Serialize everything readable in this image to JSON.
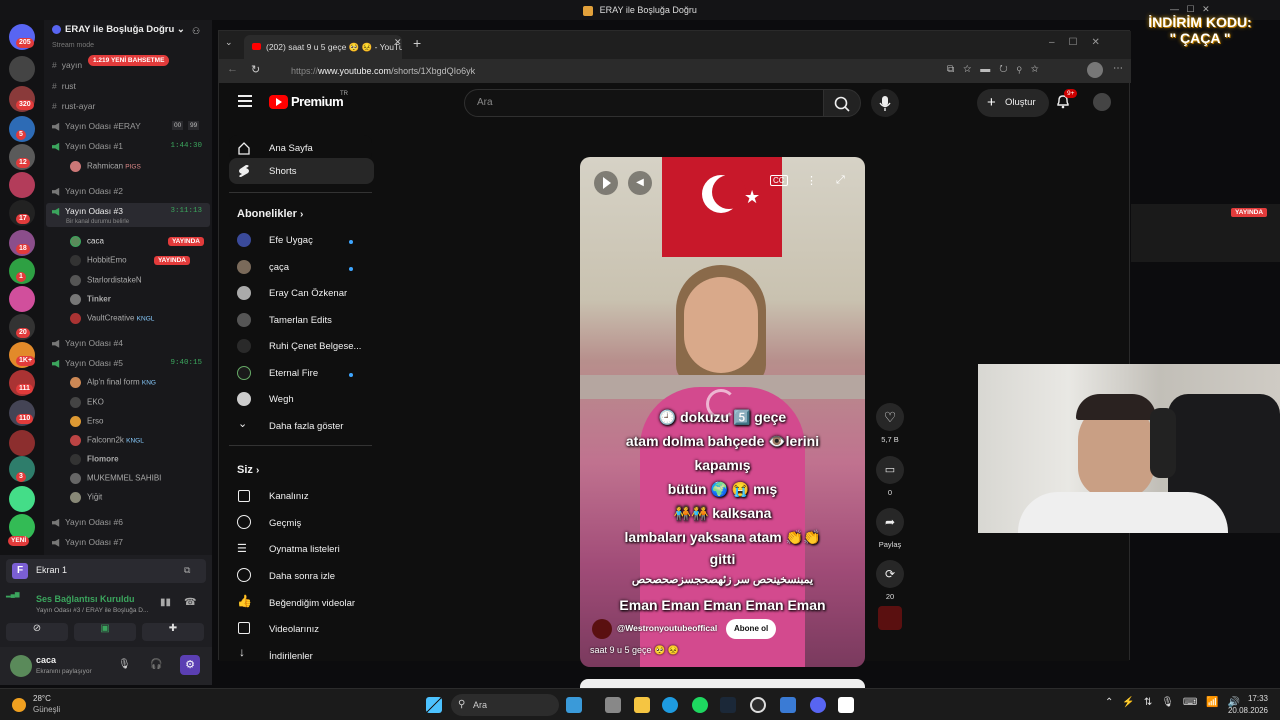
{
  "window_title": "ERAY ile Boşluğa Doğru",
  "promo": {
    "line1": "İNDİRİM KODU:",
    "line2": "\" ÇAÇA \""
  },
  "discord": {
    "server_badges": [
      "205",
      "320",
      "5",
      "12",
      "17",
      "18",
      "1",
      "20",
      "1K+",
      "111",
      "110",
      "3",
      "YENİ"
    ],
    "server_name": "ERAY ile Boşluğa Doğru",
    "stream_mode": "Stream mode",
    "new_since": "1.219 YENİ BAHSETME",
    "text_channels": [
      "yayın",
      "rust",
      "rust-ayar"
    ],
    "voice": [
      {
        "name": "Yayın Odası #ERAY",
        "counts": [
          "00",
          "99"
        ]
      },
      {
        "name": "Yayın Odası #1",
        "time": "1:44:30",
        "users": [
          {
            "name": "Rahmican",
            "tag": "PIGS"
          }
        ]
      },
      {
        "name": "Yayın Odası #2"
      },
      {
        "name": "Yayın Odası #3",
        "time": "3:11:13",
        "status": "Bir kanal durumu belirle",
        "users": [
          {
            "name": "caca",
            "live": "YAYINDA"
          },
          {
            "name": "HobbitEmo",
            "live": "YAYINDA"
          },
          {
            "name": "StarlordistakeN"
          },
          {
            "name": "Tinker"
          },
          {
            "name": "VaultCreative",
            "tag": "KNGL"
          }
        ]
      },
      {
        "name": "Yayın Odası #4"
      },
      {
        "name": "Yayın Odası #5",
        "time": "9:40:15",
        "users": [
          {
            "name": "Alp'n final form",
            "tag": "KNG"
          },
          {
            "name": "EKO"
          },
          {
            "name": "Erso"
          },
          {
            "name": "Falconn2k",
            "tag": "KNGL"
          },
          {
            "name": "Flomore"
          },
          {
            "name": "MUKEMMEL SAHIBI"
          },
          {
            "name": "Yiğit"
          }
        ]
      },
      {
        "name": "Yayın Odası #6"
      },
      {
        "name": "Yayın Odası #7"
      }
    ],
    "screen_share": "Ekran 1",
    "connection": "Ses Bağlantısı Kuruldu",
    "connection_sub": "Yayın Odası #3 / ERAY ile Boşluğa D...",
    "me_name": "caca",
    "me_status": "Ekranını paylaşıyor"
  },
  "browser": {
    "tab_title": "(202) saat 9 u 5 geçe 🥺 😣 - YouTube",
    "url_prefix": "https://",
    "url_host": "www.youtube.com",
    "url_path": "/shorts/1XbgdQIo6yk"
  },
  "youtube": {
    "logo": "Premium",
    "region": "TR",
    "search_placeholder": "Ara",
    "create": "Oluştur",
    "notif_count": "9+",
    "nav": [
      "Ana Sayfa",
      "Shorts"
    ],
    "subs_title": "Abonelikler",
    "subs": [
      {
        "name": "Efe Uygaç",
        "dot": true
      },
      {
        "name": "çaça",
        "dot": true
      },
      {
        "name": "Eray Can Özkenar",
        "dot": false
      },
      {
        "name": "Tamerlan Edits",
        "dot": false
      },
      {
        "name": "Ruhi Çenet Belgese...",
        "dot": false
      },
      {
        "name": "Eternal Fire",
        "dot": true
      },
      {
        "name": "Wegh",
        "dot": false
      },
      {
        "name": "Daha fazla göster",
        "dot": false
      }
    ],
    "you_title": "Siz",
    "you": [
      "Kanalınız",
      "Geçmiş",
      "Oynatma listeleri",
      "Daha sonra izle",
      "Beğendiğim videolar",
      "Videolarınız",
      "İndirilenler"
    ],
    "short": {
      "captions": [
        "🕘 dokuzu 5️⃣ geçe",
        "atam dolma bahçede 👁️lerini",
        "kapamış",
        "bütün 🌍 😭 mış",
        "🧑‍🤝‍🧑🧑‍🤝‍🧑 kalksana",
        "lambaları yaksana atam 👏👏",
        "gitti",
        "يمبنسخينحص سر زئهصحجسزصحصحص",
        "Eman Eman Eman Eman Eman"
      ],
      "channel": "@Westronyoutubeoffical",
      "subscribe": "Abone ol",
      "title": "saat 9 u 5 geçe 🥺 😣",
      "likes": "5,7 B",
      "comments": "0",
      "share": "Paylaş",
      "remix": "20"
    }
  },
  "overlay_live": "YAYINDA",
  "taskbar": {
    "temp": "28°C",
    "weather": "Güneşli",
    "search": "Ara",
    "time": "17:33",
    "date": "20.08.2026"
  }
}
